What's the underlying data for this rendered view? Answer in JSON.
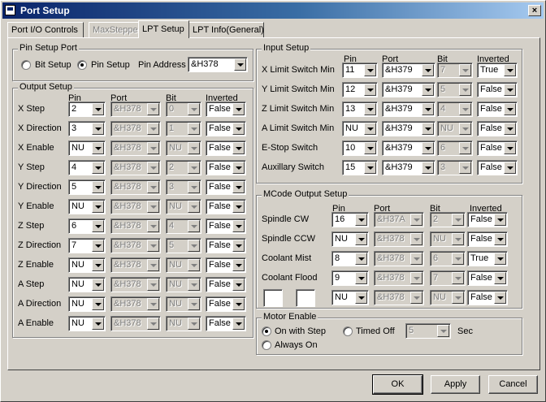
{
  "window": {
    "title": "Port Setup"
  },
  "tabs": [
    {
      "label": "Port I/O Controls",
      "state": "normal"
    },
    {
      "label": "MaxStepper",
      "state": "disabled"
    },
    {
      "label": "LPT Setup",
      "state": "active"
    },
    {
      "label": "LPT Info(General)",
      "state": "normal"
    }
  ],
  "pin_setup": {
    "title": "Pin Setup Port",
    "bit_setup": "Bit Setup",
    "pin_setup": "Pin Setup",
    "selected": "Pin Setup",
    "address_label": "Pin Address",
    "address_value": "&H378"
  },
  "headers": {
    "pin": "Pin",
    "port": "Port",
    "bit": "Bit",
    "inverted": "Inverted"
  },
  "output": {
    "title": "Output Setup",
    "rows": [
      {
        "label": "X Step",
        "pin": "2",
        "port": "&H378",
        "bit": "0",
        "inverted": "False"
      },
      {
        "label": "X Direction",
        "pin": "3",
        "port": "&H378",
        "bit": "1",
        "inverted": "False"
      },
      {
        "label": "X Enable",
        "pin": "NU",
        "port": "&H378",
        "bit": "NU",
        "inverted": "False"
      },
      {
        "label": "Y Step",
        "pin": "4",
        "port": "&H378",
        "bit": "2",
        "inverted": "False"
      },
      {
        "label": "Y Direction",
        "pin": "5",
        "port": "&H378",
        "bit": "3",
        "inverted": "False"
      },
      {
        "label": "Y Enable",
        "pin": "NU",
        "port": "&H378",
        "bit": "NU",
        "inverted": "False"
      },
      {
        "label": "Z Step",
        "pin": "6",
        "port": "&H378",
        "bit": "4",
        "inverted": "False"
      },
      {
        "label": "Z Direction",
        "pin": "7",
        "port": "&H378",
        "bit": "5",
        "inverted": "False"
      },
      {
        "label": "Z Enable",
        "pin": "NU",
        "port": "&H378",
        "bit": "NU",
        "inverted": "False"
      },
      {
        "label": "A Step",
        "pin": "NU",
        "port": "&H378",
        "bit": "NU",
        "inverted": "False"
      },
      {
        "label": "A Direction",
        "pin": "NU",
        "port": "&H378",
        "bit": "NU",
        "inverted": "False"
      },
      {
        "label": "A Enable",
        "pin": "NU",
        "port": "&H378",
        "bit": "NU",
        "inverted": "False"
      }
    ]
  },
  "input": {
    "title": "Input Setup",
    "rows": [
      {
        "label": "X Limit Switch Min",
        "pin": "11",
        "port": "&H379",
        "bit": "7",
        "inverted": "True"
      },
      {
        "label": "Y Limit Switch Min",
        "pin": "12",
        "port": "&H379",
        "bit": "5",
        "inverted": "False"
      },
      {
        "label": "Z Limit Switch Min",
        "pin": "13",
        "port": "&H379",
        "bit": "4",
        "inverted": "False"
      },
      {
        "label": "A Limit Switch Min",
        "pin": "NU",
        "port": "&H379",
        "bit": "NU",
        "inverted": "False"
      },
      {
        "label": "E-Stop Switch",
        "pin": "10",
        "port": "&H379",
        "bit": "6",
        "inverted": "False"
      },
      {
        "label": "Auxillary Switch",
        "pin": "15",
        "port": "&H379",
        "bit": "3",
        "inverted": "False"
      }
    ]
  },
  "mcode": {
    "title": "MCode Output Setup",
    "rows": [
      {
        "label": "Spindle CW",
        "pin": "16",
        "port": "&H37A",
        "bit": "2",
        "inverted": "False"
      },
      {
        "label": "Spindle CCW",
        "pin": "NU",
        "port": "&H378",
        "bit": "NU",
        "inverted": "False"
      },
      {
        "label": "Coolant Mist",
        "pin": "8",
        "port": "&H378",
        "bit": "6",
        "inverted": "True"
      },
      {
        "label": "Coolant Flood",
        "pin": "9",
        "port": "&H378",
        "bit": "7",
        "inverted": "False"
      },
      {
        "label": "",
        "pin": "NU",
        "port": "&H378",
        "bit": "NU",
        "inverted": "False"
      }
    ]
  },
  "motor": {
    "title": "Motor Enable",
    "on_with_step": "On with Step",
    "timed_off": "Timed Off",
    "always_on": "Always On",
    "selected": "On with Step",
    "timed_value": "5",
    "unit": "Sec"
  },
  "buttons": {
    "ok": "OK",
    "apply": "Apply",
    "cancel": "Cancel"
  }
}
